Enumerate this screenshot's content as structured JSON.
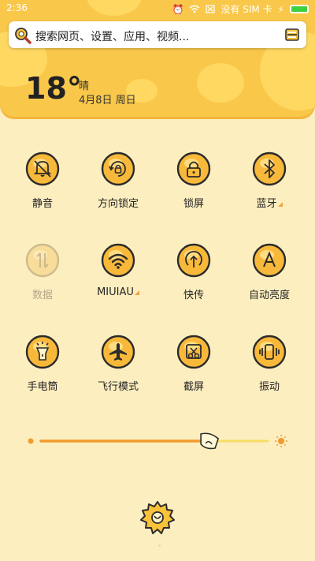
{
  "status_bar": {
    "time": "2:36",
    "carrier": "没有 SIM 卡"
  },
  "search": {
    "placeholder": "搜索网页、设置、应用、视频..."
  },
  "weather": {
    "temperature": "18°",
    "condition": "晴",
    "date": "4月8日 周日"
  },
  "toggles": [
    {
      "label": "静音",
      "icon": "bell-off-icon",
      "dim": false,
      "has_more": false
    },
    {
      "label": "方向锁定",
      "icon": "rotation-lock-icon",
      "dim": false,
      "has_more": false
    },
    {
      "label": "锁屏",
      "icon": "lock-icon",
      "dim": false,
      "has_more": false
    },
    {
      "label": "蓝牙",
      "icon": "bluetooth-icon",
      "dim": false,
      "has_more": true
    },
    {
      "label": "数据",
      "icon": "mobile-data-icon",
      "dim": true,
      "has_more": false
    },
    {
      "label": "MIUIAU",
      "icon": "wifi-icon",
      "dim": false,
      "has_more": true
    },
    {
      "label": "快传",
      "icon": "quick-transfer-icon",
      "dim": false,
      "has_more": false
    },
    {
      "label": "自动亮度",
      "icon": "auto-brightness-icon",
      "dim": false,
      "has_more": false
    },
    {
      "label": "手电筒",
      "icon": "flashlight-icon",
      "dim": false,
      "has_more": false
    },
    {
      "label": "飞行模式",
      "icon": "airplane-icon",
      "dim": false,
      "has_more": false
    },
    {
      "label": "截屏",
      "icon": "screenshot-icon",
      "dim": false,
      "has_more": false
    },
    {
      "label": "振动",
      "icon": "vibrate-icon",
      "dim": false,
      "has_more": false
    }
  ],
  "brightness": {
    "level": 0.74
  },
  "colors": {
    "accent": "#f9c84a",
    "tile_fill": "#f8b93a",
    "background": "#fdeec0",
    "slider": "#f29a2e"
  }
}
